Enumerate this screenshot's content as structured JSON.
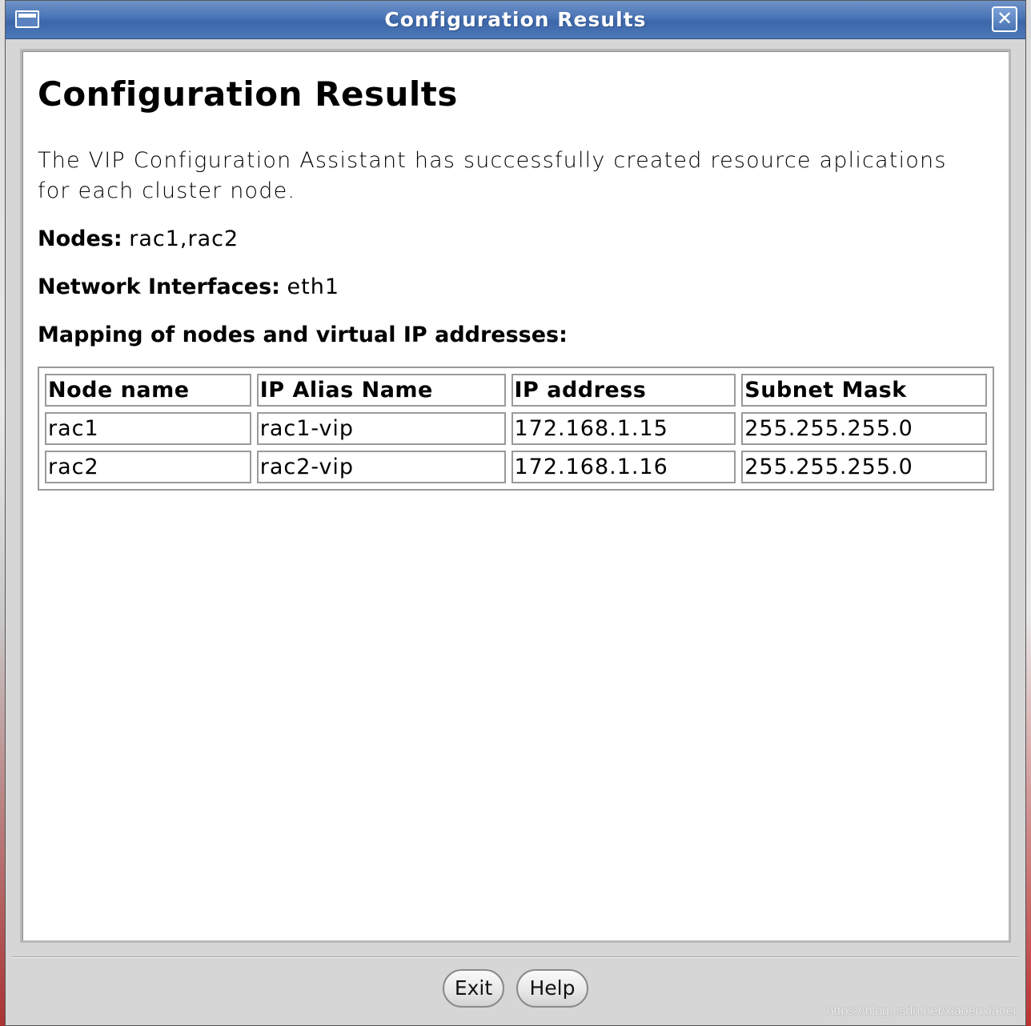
{
  "window": {
    "title": "Configuration Results",
    "close_glyph": "✕"
  },
  "content": {
    "heading": "Configuration Results",
    "description": "The VIP Configuration Assistant has successfully created resource aplications for each cluster node.",
    "nodes_label": "Nodes:",
    "nodes_value": "rac1,rac2",
    "interfaces_label": "Network Interfaces:",
    "interfaces_value": "eth1",
    "mapping_heading": "Mapping of nodes and virtual IP addresses:"
  },
  "table": {
    "headers": [
      "Node name",
      "IP Alias Name",
      "IP address",
      "Subnet Mask"
    ],
    "rows": [
      [
        "rac1",
        "rac1-vip",
        "172.168.1.15",
        "255.255.255.0"
      ],
      [
        "rac2",
        "rac2-vip",
        "172.168.1.16",
        "255.255.255.0"
      ]
    ]
  },
  "buttons": {
    "exit_label": "Exit",
    "help_label": "Help"
  },
  "watermark": "https://blog.csdn.net/xiaoenxiaoer",
  "colors": {
    "titlebar": "#4a74b5",
    "panel_bg": "#ffffff",
    "window_bg": "#d6d6d6"
  }
}
